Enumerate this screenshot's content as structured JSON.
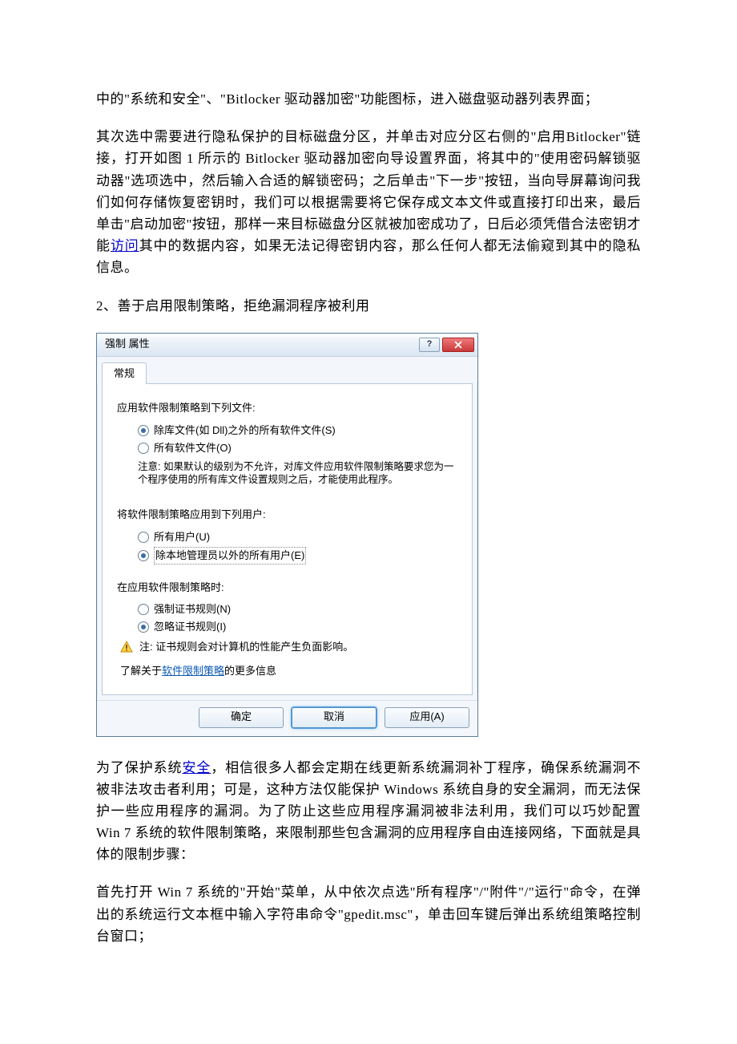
{
  "paragraphs": {
    "p1_a": "中的\"系统和安全\"、\"Bitlocker 驱动器加密\"功能图标，进入磁盘驱动器列表界面；",
    "p2_a": "其次选中需要进行隐私保护的目标磁盘分区，并单击对应分区右侧的\"启用Bitlocker\"链接，打开如图 1 所示的 Bitlocker 驱动器加密向导设置界面，将其中的\"使用密码解锁驱动器\"选项选中，然后输入合适的解锁密码；之后单击\"下一步\"按钮，当向导屏幕询问我们如何存储恢复密钥时，我们可以根据需要将它保存成文本文件或直接打印出来，最后单击\"启动加密\"按钮，那样一来目标磁盘分区就被加密成功了，日后必须凭借合法密钥才能",
    "p2_link": "访问",
    "p2_b": "其中的数据内容，如果无法记得密钥内容，那么任何人都无法偷窥到其中的隐私信息。",
    "p3": "2、善于启用限制策略，拒绝漏洞程序被利用",
    "p4_a": "为了保护系统",
    "p4_link": "安全",
    "p4_b": "，相信很多人都会定期在线更新系统漏洞补丁程序，确保系统漏洞不被非法攻击者利用；可是，这种方法仅能保护 Windows 系统自身的安全漏洞，而无法保护一些应用程序的漏洞。为了防止这些应用程序漏洞被非法利用，我们可以巧妙配置 Win 7 系统的软件限制策略，来限制那些包含漏洞的应用程序自由连接网络，下面就是具体的限制步骤：",
    "p5": "首先打开 Win 7 系统的\"开始\"菜单，从中依次点选\"所有程序\"/\"附件\"/\"运行\"命令，在弹出的系统运行文本框中输入字符串命令\"gpedit.msc\"，单击回车键后弹出系统组策略控制台窗口；"
  },
  "dialog": {
    "title": "强制 属性",
    "tab": "常规",
    "section1_label": "应用软件限制策略到下列文件:",
    "s1_opt1": "除库文件(如 Dll)之外的所有软件文件(S)",
    "s1_opt2": "所有软件文件(O)",
    "note1": "注意: 如果默认的级别为不允许，对库文件应用软件限制策略要求您为一个程序使用的所有库文件设置规则之后，才能使用此程序。",
    "section2_label": "将软件限制策略应用到下列用户:",
    "s2_opt1": "所有用户(U)",
    "s2_opt2": "除本地管理员以外的所有用户(E)",
    "section3_label": "在应用软件限制策略时:",
    "s3_opt1": "强制证书规则(N)",
    "s3_opt2": "忽略证书规则(I)",
    "warn": "注: 证书规则会对计算机的性能产生负面影响。",
    "learn_a": "了解关于",
    "learn_link": "软件限制策略",
    "learn_b": "的更多信息",
    "btn_ok": "确定",
    "btn_cancel": "取消",
    "btn_apply": "应用(A)"
  }
}
